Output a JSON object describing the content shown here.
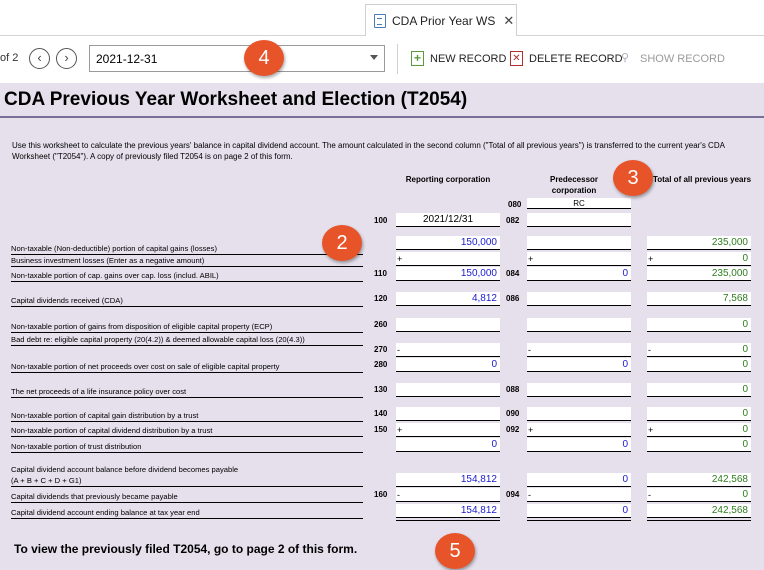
{
  "tab": {
    "title": "CDA Prior Year WS",
    "close": "✕"
  },
  "toolbar": {
    "page_of": "of 2",
    "date": "2021-12-31",
    "new_record": "NEW RECORD",
    "delete_record": "DELETE RECORD",
    "show_record": "SHOW RECORD"
  },
  "form": {
    "title": "CDA Previous Year Worksheet and Election (T2054)",
    "intro": "Use this worksheet to calculate the previous years' balance in capital dividend account. The amount calculated in the second column (\"Total of all previous years\") is transferred to the current year's CDA Worksheet (\"T2054\"). A copy of previously filed T2054 is on page 2 of this form.",
    "col_reporting": "Reporting corporation",
    "col_predecessor": "Predecessor corporation",
    "col_total": "Total of all previous years",
    "code_080": "080",
    "rc": "RC",
    "code_100": "100",
    "date_value": "2021/12/31",
    "code_082": "082",
    "footnote": "To view the previously filed T2054, go to page 2 of this form."
  },
  "rows": [
    {
      "label": "Non-taxable (Non-deductible) portion of capital gains (losses)",
      "reporting": "150,000",
      "total": "235,000"
    },
    {
      "label": "Business investment losses (Enter as a negative amount)",
      "reporting_prefix": "+",
      "pred_prefix": "+",
      "total_prefix": "+",
      "total": "0"
    },
    {
      "label": "Non-taxable portion of cap. gains over cap. loss (includ. ABIL)",
      "code": "110",
      "reporting": "150,000",
      "code2": "084",
      "pred": "0",
      "total": "235,000"
    },
    {
      "label": "Capital dividends received (CDA)",
      "code": "120",
      "reporting": "4,812",
      "code2": "086",
      "total": "7,568"
    },
    {
      "label": "Non-taxable portion of gains from disposition of eligible capital property (ECP)",
      "code": "260",
      "total": "0"
    },
    {
      "label": "Bad debt re: eligible capital property (20(4.2)) & deemed allowable capital loss (20(4.3))",
      "code": "270",
      "reporting_prefix": "-",
      "pred_prefix": "-",
      "total_prefix": "-",
      "total": "0"
    },
    {
      "label": "Non-taxable portion of net proceeds over cost on sale of eligible capital property",
      "code": "280",
      "reporting": "0",
      "pred": "0",
      "total": "0"
    },
    {
      "label": "The net proceeds of a life insurance policy over cost",
      "code": "130",
      "code2": "088",
      "total": "0"
    },
    {
      "label": "Non-taxable portion of capital gain distribution by a trust",
      "code": "140",
      "code2": "090",
      "total": "0"
    },
    {
      "label": "Non-taxable portion of capital dividend distribution by a trust",
      "code": "150",
      "reporting_prefix": "+",
      "code2": "092",
      "pred_prefix": "+",
      "total_prefix": "+",
      "total": "0"
    },
    {
      "label": "Non-taxable portion of trust distribution",
      "reporting": "0",
      "pred": "0",
      "total": "0"
    },
    {
      "label": "Capital dividend account balance before dividend becomes payable",
      "label2": "(A + B + C + D + G1)",
      "reporting": "154,812",
      "pred": "0",
      "total": "242,568"
    },
    {
      "label": "Capital dividends that previously became payable",
      "code": "160",
      "reporting_prefix": "-",
      "code2": "094",
      "pred_prefix": "-",
      "total_prefix": "-",
      "total": "0"
    },
    {
      "label": "Capital dividend account ending balance at tax year end",
      "reporting": "154,812",
      "pred": "0",
      "total": "242,568"
    }
  ],
  "callouts": [
    "2",
    "3",
    "4",
    "5"
  ]
}
